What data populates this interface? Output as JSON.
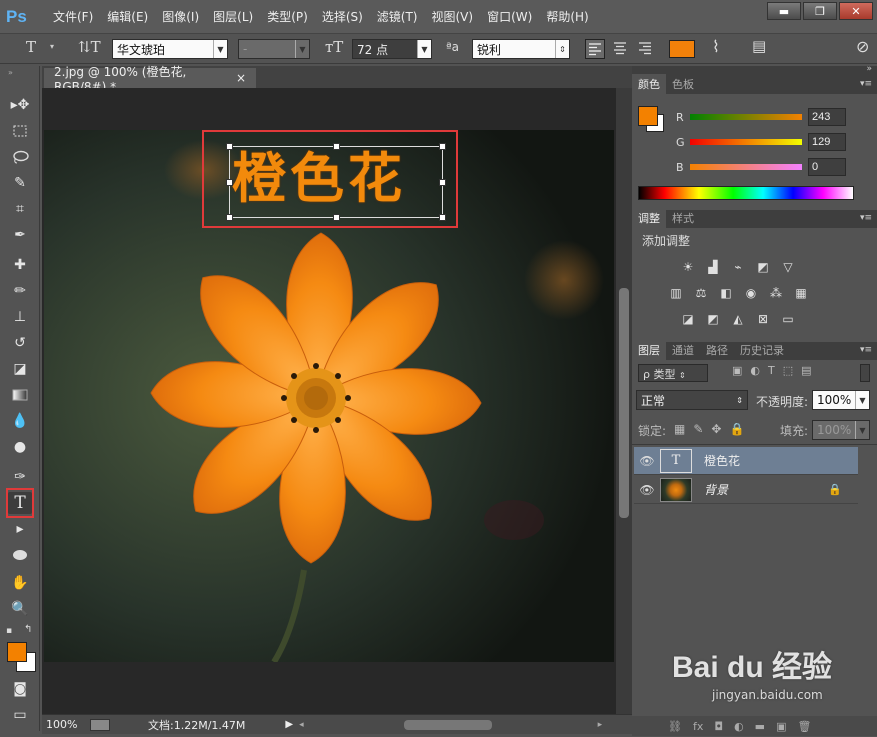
{
  "app": {
    "logo": "Ps"
  },
  "menu": [
    "文件(F)",
    "编辑(E)",
    "图像(I)",
    "图层(L)",
    "类型(P)",
    "选择(S)",
    "滤镜(T)",
    "视图(V)",
    "窗口(W)",
    "帮助(H)"
  ],
  "window_buttons": [
    "▬",
    "❐",
    "✕"
  ],
  "options": {
    "font_family": "华文琥珀",
    "font_style": "-",
    "font_size": "72 点",
    "aa_label": "ªa",
    "antialias": "锐利",
    "color_swatch": "#f2810a"
  },
  "document": {
    "tab_title": "2.jpg @ 100% (橙色花, RGB/8#) *",
    "tab_close": "×",
    "text_layer": "橙色花"
  },
  "status": {
    "zoom": "100%",
    "doc_info": "文档:1.22M/1.47M"
  },
  "color_panel": {
    "tabs": [
      "颜色",
      "色板"
    ],
    "foreground": "#f38100",
    "labels": {
      "r": "R",
      "g": "G",
      "b": "B"
    },
    "r": "243",
    "g": "129",
    "b": "0"
  },
  "adjustments_panel": {
    "tabs": [
      "调整",
      "样式"
    ],
    "title": "添加调整"
  },
  "layers_panel": {
    "tabs": [
      "图层",
      "通道",
      "路径",
      "历史记录"
    ],
    "filter_kind": "ρ 类型",
    "blend_mode": "正常",
    "opacity_label": "不透明度:",
    "opacity": "100%",
    "lock_label": "锁定:",
    "fill_label": "填充:",
    "fill": "100%",
    "layers": [
      {
        "name": "橙色花",
        "type": "T",
        "selected": true
      },
      {
        "name": "背景",
        "locked": true
      }
    ]
  },
  "watermark": {
    "text": "Bai du 经验",
    "url": "jingyan.baidu.com"
  }
}
